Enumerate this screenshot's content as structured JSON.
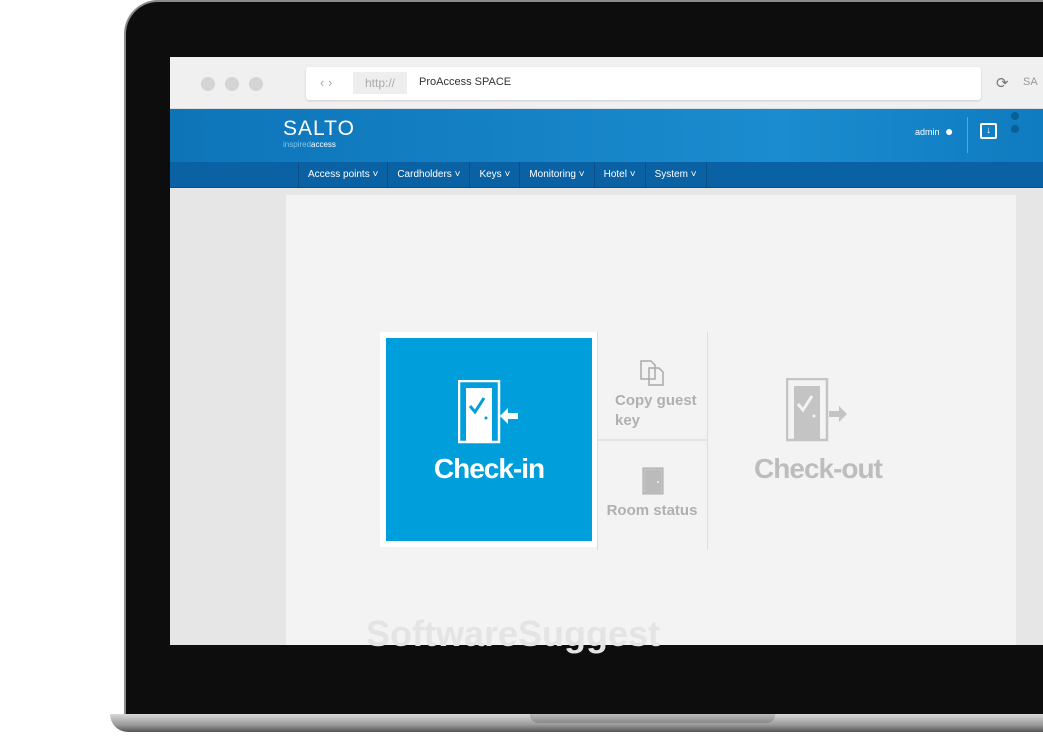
{
  "browser": {
    "nav_arrows": "‹ ›",
    "protocol": "http://",
    "url_title": "ProAccess SPACE",
    "right_tab_text": "SA"
  },
  "header": {
    "logo": "SALTO",
    "tagline_light": "inspired",
    "tagline_bold": "access",
    "user": "admin"
  },
  "menu": [
    {
      "label": "Access points"
    },
    {
      "label": "Cardholders"
    },
    {
      "label": "Keys"
    },
    {
      "label": "Monitoring"
    },
    {
      "label": "Hotel"
    },
    {
      "label": "System"
    }
  ],
  "tiles": {
    "checkin": "Check-in",
    "copy_guest_key": "Copy guest key",
    "room_status": "Room status",
    "checkout": "Check-out"
  },
  "watermark": "SoftwareSuggest",
  "colors": {
    "accent": "#009edb",
    "header": "#1b8ccf",
    "menubar": "#0a62a4",
    "inactive": "#b0b0b0"
  }
}
